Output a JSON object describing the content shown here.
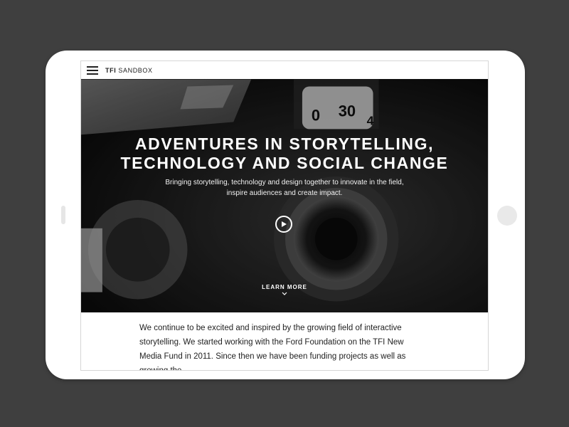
{
  "brand": {
    "bold": "TFI",
    "rest": " SANDBOX"
  },
  "hero": {
    "title_line1": "ADVENTURES IN STORYTELLING,",
    "title_line2": "TECHNOLOGY AND SOCIAL CHANGE",
    "subtitle_line1": "Bringing storytelling, technology and design together to innovate in the field,",
    "subtitle_line2": "inspire audiences and create impact.",
    "learn_more": "LEARN MORE",
    "dial_numbers": [
      "0",
      "30",
      "4"
    ]
  },
  "content": {
    "paragraph": "We continue to be excited and inspired by the growing field of interactive storytelling. We started working with the Ford Foundation on the TFI New Media Fund in 2011. Since then we have been funding projects as well as growing the"
  }
}
